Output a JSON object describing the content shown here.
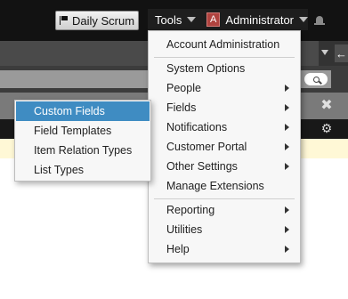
{
  "header": {
    "scrum_button_label": "Daily Scrum",
    "tools_label": "Tools",
    "admin_avatar_letter": "A",
    "admin_label": "Administrator"
  },
  "tools_menu": {
    "items": [
      {
        "label": "Account Administration",
        "has_submenu": false
      },
      {
        "label": "System Options",
        "has_submenu": false
      },
      {
        "label": "People",
        "has_submenu": true
      },
      {
        "label": "Fields",
        "has_submenu": true
      },
      {
        "label": "Notifications",
        "has_submenu": true
      },
      {
        "label": "Customer Portal",
        "has_submenu": true
      },
      {
        "label": "Other Settings",
        "has_submenu": true
      },
      {
        "label": "Manage Extensions",
        "has_submenu": false
      },
      {
        "label": "Reporting",
        "has_submenu": true
      },
      {
        "label": "Utilities",
        "has_submenu": true
      },
      {
        "label": "Help",
        "has_submenu": true
      }
    ]
  },
  "fields_submenu": {
    "items": [
      {
        "label": "Custom Fields",
        "active": true
      },
      {
        "label": "Field Templates",
        "active": false
      },
      {
        "label": "Item Relation Types",
        "active": false
      },
      {
        "label": "List Types",
        "active": false
      }
    ]
  },
  "colors": {
    "topbar": "#121212",
    "active_item": "#3f8cc2",
    "avatar": "#b0433f",
    "highlight_row": "#fff8d6"
  },
  "icons": [
    "flag-icon",
    "chevron-down-icon",
    "bell-icon",
    "filter-icon",
    "arrow-left-icon",
    "search-icon",
    "close-icon",
    "gear-icon",
    "submenu-arrow-icon"
  ]
}
